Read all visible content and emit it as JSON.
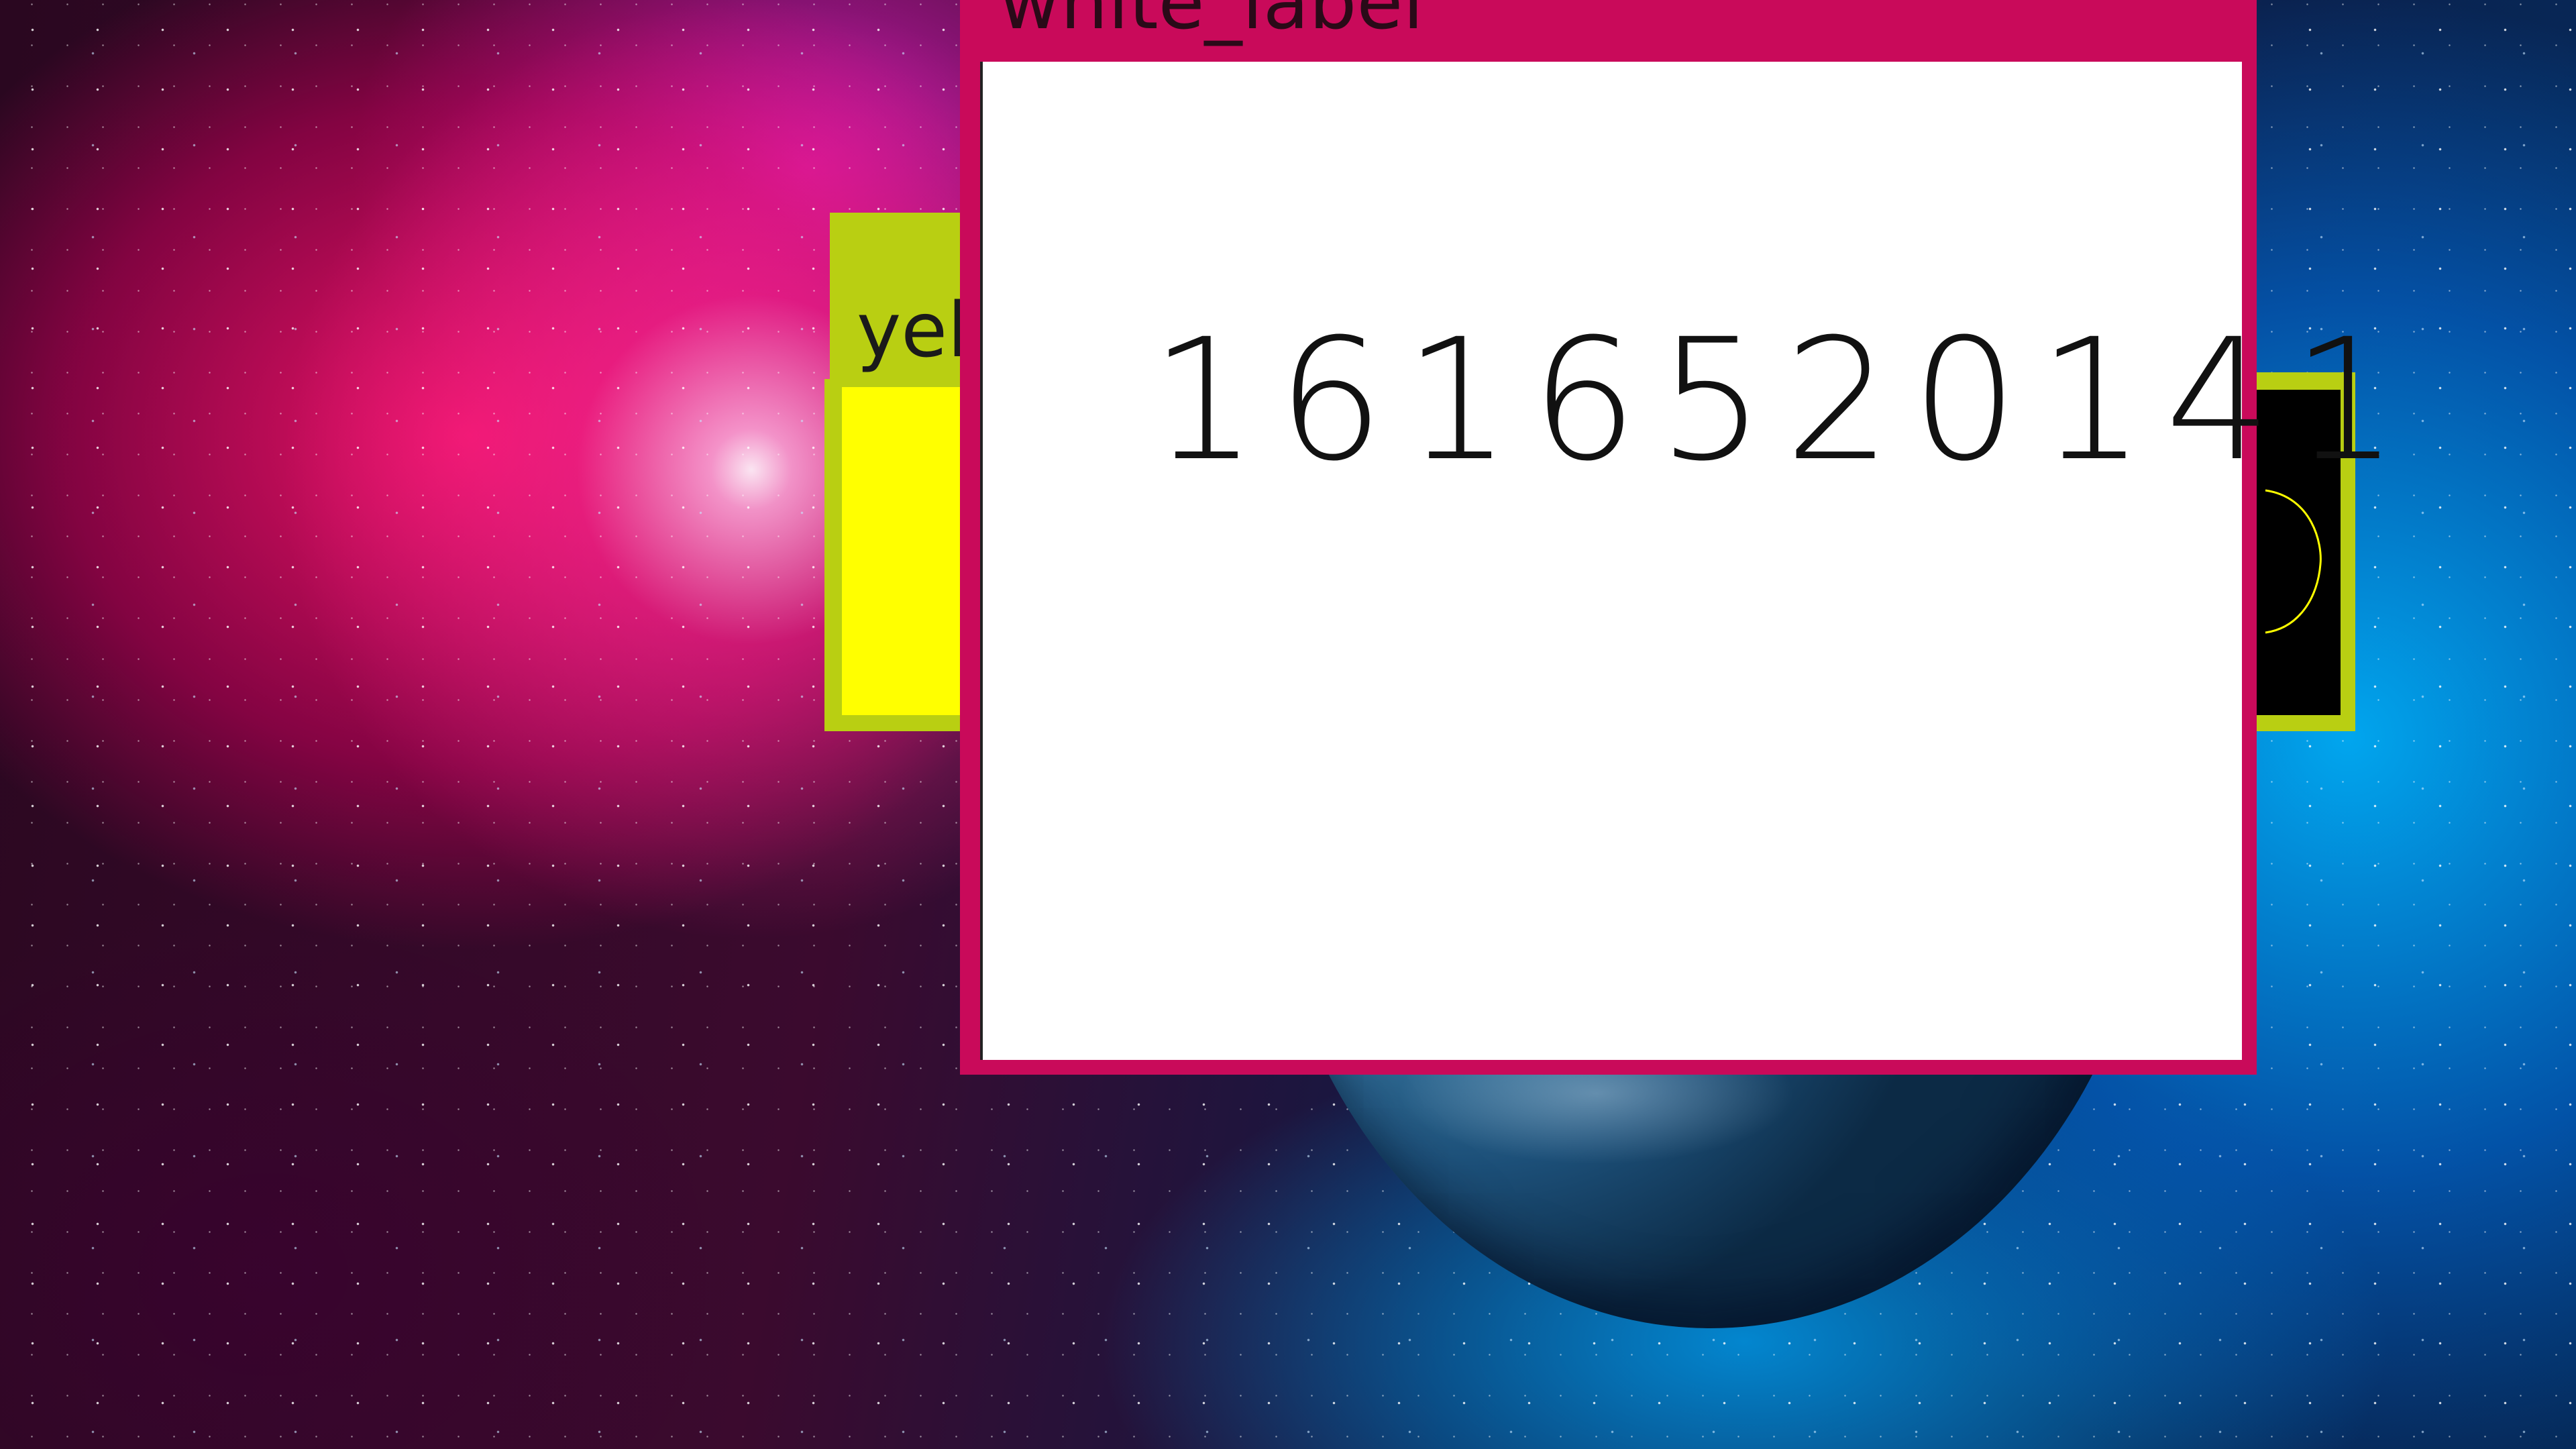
{
  "desktop": {
    "wallpaper": "space-nebula-with-planet"
  },
  "yellow_window": {
    "title": "yel",
    "titlebar_color": "#b9cf12",
    "content_color": "#ffff00"
  },
  "black_window": {
    "frame_color": "#b9cf12",
    "content_color": "#000000",
    "icon": "circle-outline-icon",
    "icon_color": "#ffff00"
  },
  "white_window": {
    "title": "white_label",
    "frame_color": "#c90a5a",
    "content_color": "#ffffff",
    "value": "1616520141"
  }
}
